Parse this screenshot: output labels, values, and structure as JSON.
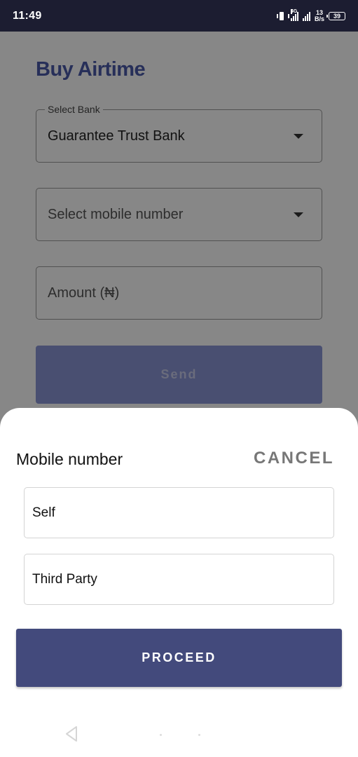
{
  "status_bar": {
    "time": "11:49",
    "network_type": "4G",
    "speed_value": "13",
    "speed_unit": "B/s",
    "battery": "39",
    "icons": [
      "vibrate-icon",
      "signal-icon",
      "signal-icon",
      "battery-icon"
    ]
  },
  "page": {
    "title": "Buy Airtime",
    "bank_field": {
      "label": "Select Bank",
      "value": "Guarantee Trust Bank"
    },
    "mobile_field": {
      "placeholder": "Select mobile number"
    },
    "amount_field": {
      "placeholder": "Amount (₦)"
    },
    "send_label": "Send"
  },
  "sheet": {
    "title": "Mobile number",
    "cancel_label": "CANCEL",
    "options": [
      {
        "label": "Self"
      },
      {
        "label": "Third Party"
      }
    ],
    "proceed_label": "PROCEED"
  },
  "nav_bar": {
    "icons": [
      "back-icon",
      "home-icon",
      "recents-icon"
    ]
  },
  "colors": {
    "status_bar_bg": "#1c1d31",
    "brand": "#4b5aa8",
    "proceed_bg": "#434a7c",
    "scrim": "rgba(0,0,0,0.47)"
  }
}
